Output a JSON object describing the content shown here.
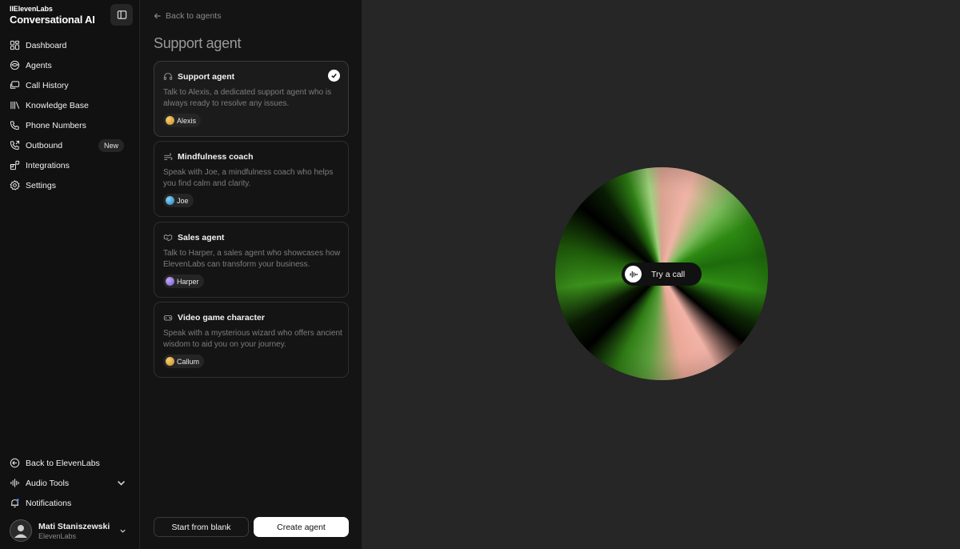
{
  "brand": {
    "top": "IIElevenLabs",
    "main": "Conversational AI"
  },
  "nav": {
    "items": [
      {
        "label": "Dashboard",
        "icon": "grid-icon"
      },
      {
        "label": "Agents",
        "icon": "agents-icon"
      },
      {
        "label": "Call History",
        "icon": "chat-icon"
      },
      {
        "label": "Knowledge Base",
        "icon": "books-icon"
      },
      {
        "label": "Phone Numbers",
        "icon": "phone-icon"
      },
      {
        "label": "Outbound",
        "icon": "phone-outgoing-icon",
        "badge": "New"
      },
      {
        "label": "Integrations",
        "icon": "puzzle-icon"
      },
      {
        "label": "Settings",
        "icon": "gear-icon"
      }
    ],
    "bottom": [
      {
        "label": "Back to ElevenLabs",
        "icon": "arrow-left-circle-icon"
      },
      {
        "label": "Audio Tools",
        "icon": "waveform-icon"
      },
      {
        "label": "Notifications",
        "icon": "bell-icon"
      }
    ]
  },
  "user": {
    "name": "Mati Staniszewski",
    "org": "ElevenLabs"
  },
  "panel": {
    "back_label": "Back to agents",
    "title": "Support agent",
    "cards": [
      {
        "title": "Support agent",
        "desc": "Talk to Alexis, a dedicated support agent who is always ready to resolve any issues.",
        "chip": "Alexis",
        "selected": true
      },
      {
        "title": "Mindfulness coach",
        "desc": "Speak with Joe, a mindfulness coach who helps you find calm and clarity.",
        "chip": "Joe",
        "selected": false
      },
      {
        "title": "Sales agent",
        "desc": "Talk to Harper, a sales agent who showcases how ElevenLabs can transform your business.",
        "chip": "Harper",
        "selected": false
      },
      {
        "title": "Video game character",
        "desc": "Speak with a mysterious wizard who offers ancient wisdom to aid you on your journey.",
        "chip": "Callum",
        "selected": false
      }
    ],
    "buttons": {
      "blank": "Start from blank",
      "create": "Create agent"
    }
  },
  "stage": {
    "call_label": "Try a call"
  },
  "colors": {
    "accent_green": "#2e8a13",
    "accent_pink": "#f0b4a6",
    "background": "#262626",
    "sidebar": "#111111"
  }
}
